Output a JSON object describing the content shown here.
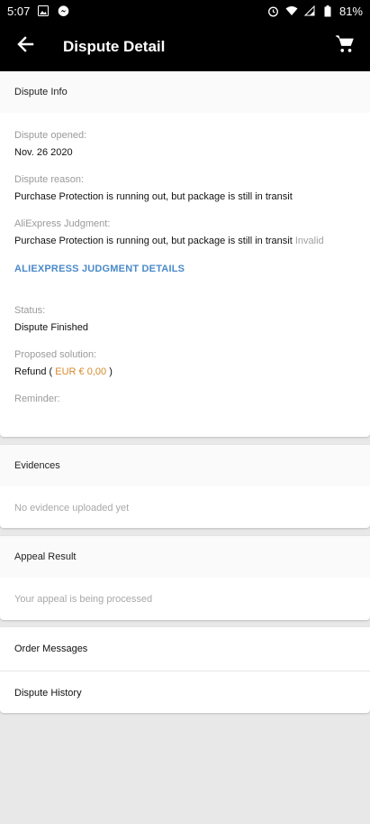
{
  "status_bar": {
    "time": "5:07",
    "battery": "81%"
  },
  "app_bar": {
    "title": "Dispute Detail"
  },
  "dispute_info": {
    "header": "Dispute Info",
    "opened_label": "Dispute opened:",
    "opened_value": "Nov. 26 2020",
    "reason_label": "Dispute reason:",
    "reason_value": "Purchase Protection is running out, but package is still in transit",
    "judgment_label": "AliExpress Judgment:",
    "judgment_value": "Purchase Protection is running out, but package is still in transit",
    "judgment_status": "Invalid",
    "judgment_link": "ALIEXPRESS JUDGMENT DETAILS",
    "status_label": "Status:",
    "status_value": "Dispute Finished",
    "solution_label": "Proposed solution:",
    "solution_prefix": "Refund (",
    "solution_amount": "EUR € 0,00",
    "solution_suffix": ")",
    "reminder_label": "Reminder:"
  },
  "evidences": {
    "header": "Evidences",
    "empty": "No evidence uploaded yet"
  },
  "appeal": {
    "header": "Appeal Result",
    "message": "Your appeal is being processed"
  },
  "links": {
    "order_messages": "Order Messages",
    "dispute_history": "Dispute History"
  },
  "icons": {
    "back": "arrow-back-icon",
    "cart": "cart-icon"
  }
}
